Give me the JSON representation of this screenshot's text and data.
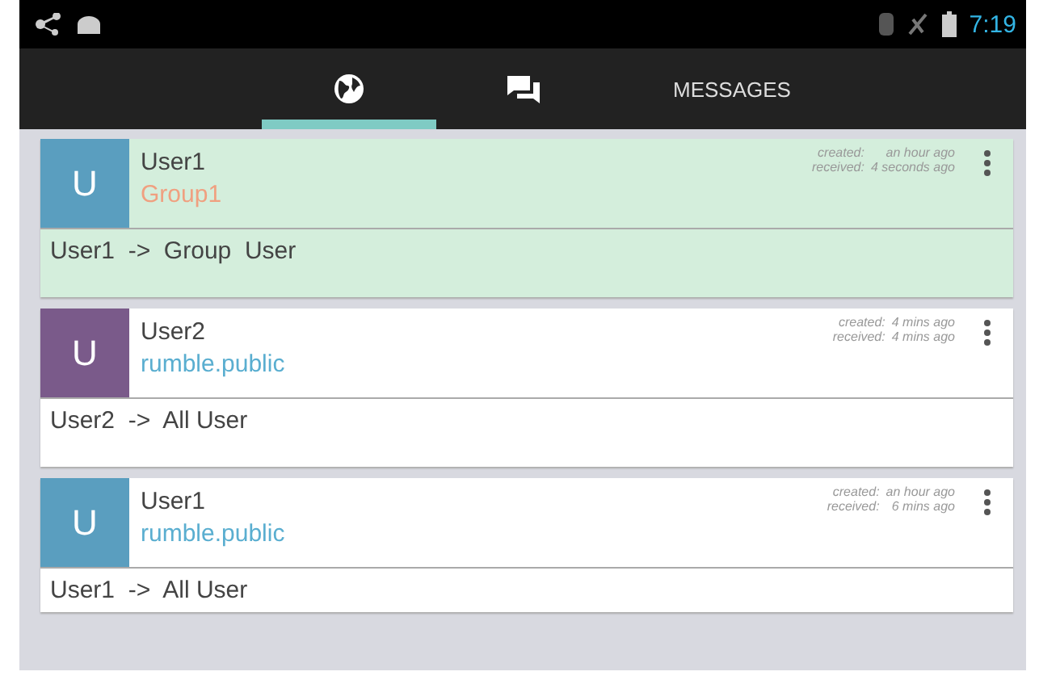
{
  "status_bar": {
    "time": "7:19"
  },
  "tabs": [
    {
      "kind": "globe",
      "selected": true
    },
    {
      "kind": "chat",
      "selected": false
    },
    {
      "kind": "text",
      "label": "MESSAGES",
      "selected": false
    }
  ],
  "messages": [
    {
      "avatar": {
        "letter": "U",
        "color": "#5a9ebf"
      },
      "author": "User1",
      "group": {
        "name": "Group1",
        "color": "#f0a080"
      },
      "created_label": "created:",
      "created": "an hour ago",
      "received_label": "received:",
      "received": "4 seconds ago",
      "text": "User1  ->  Group  User",
      "selected": true
    },
    {
      "avatar": {
        "letter": "U",
        "color": "#7a5a8a"
      },
      "author": "User2",
      "group": {
        "name": "rumble.public",
        "color": "#5aaed0"
      },
      "created_label": "created:",
      "created": "4 mins ago",
      "received_label": "received:",
      "received": "4 mins ago",
      "text": "User2  ->  All User",
      "selected": false
    },
    {
      "avatar": {
        "letter": "U",
        "color": "#5a9ebf"
      },
      "author": "User1",
      "group": {
        "name": "rumble.public",
        "color": "#5aaed0"
      },
      "created_label": "created:",
      "created": "an hour ago",
      "received_label": "received:",
      "received": "6 mins ago",
      "text": "User1  ->  All User",
      "selected": false
    }
  ]
}
